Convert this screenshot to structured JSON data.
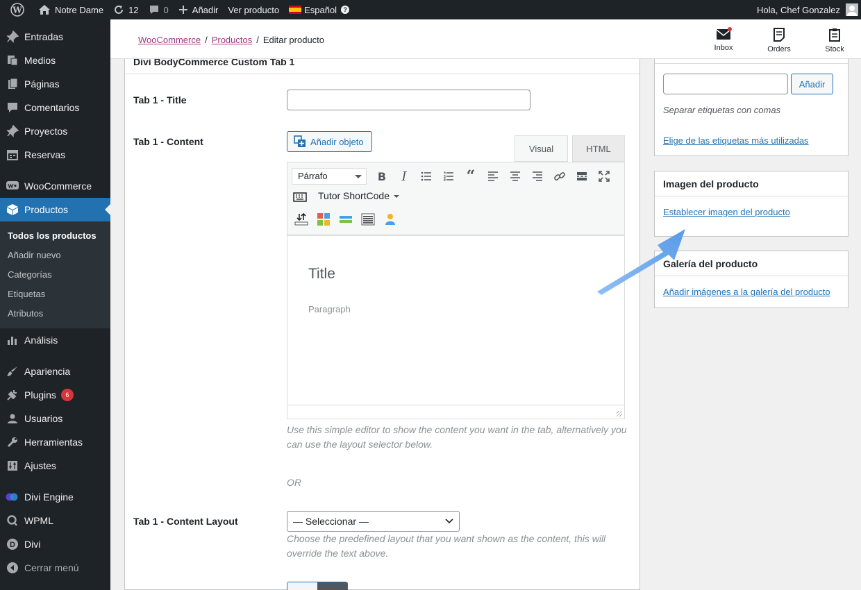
{
  "adminbar": {
    "site_name": "Notre Dame",
    "updates_count": "12",
    "comments_count": "0",
    "new_label": "Añadir",
    "view_label": "Ver producto",
    "language_label": "Español",
    "greeting": "Hola, Chef Gonzalez"
  },
  "sidebar": {
    "items_top": [
      {
        "label": "Entradas",
        "icon": "pushpin-icon"
      },
      {
        "label": "Medios",
        "icon": "media-icon"
      },
      {
        "label": "Páginas",
        "icon": "pages-icon"
      },
      {
        "label": "Comentarios",
        "icon": "comment-icon"
      },
      {
        "label": "Proyectos",
        "icon": "pushpin-icon"
      },
      {
        "label": "Reservas",
        "icon": "calendar-icon"
      }
    ],
    "woocommerce": "WooCommerce",
    "productos": "Productos",
    "submenu": [
      "Todos los productos",
      "Añadir nuevo",
      "Categorías",
      "Etiquetas",
      "Atributos"
    ],
    "analisis": "Análisis",
    "apariencia": "Apariencia",
    "plugins": "Plugins",
    "plugins_badge": "6",
    "usuarios": "Usuarios",
    "herramientas": "Herramientas",
    "ajustes": "Ajustes",
    "divi_engine": "Divi Engine",
    "wpml": "WPML",
    "divi": "Divi",
    "collapse": "Cerrar menú"
  },
  "header": {
    "crumb_1": "WooCommerce",
    "crumb_2": "Productos",
    "crumb_3": "Editar producto",
    "sep": "/",
    "inbox": "Inbox",
    "orders": "Orders",
    "stock": "Stock"
  },
  "panel": {
    "title": "Divi BodyCommerce Custom Tab 1",
    "tab_title_label": "Tab 1 - Title",
    "tab_title_value": "",
    "tab_content_label": "Tab 1 - Content",
    "add_object": "Añadir objeto",
    "tab_visual": "Visual",
    "tab_html": "HTML",
    "format_select": "Párrafo",
    "tutor_shortcode": "Tutor ShortCode",
    "editor_title": "Title",
    "editor_paragraph": "Paragraph",
    "help_text": "Use this simple editor to show the content you want in the tab, alternatively you can use the layout selector below.",
    "or_text": "OR",
    "layout_label": "Tab 1 - Content Layout",
    "layout_select": "— Seleccionar —",
    "layout_help": "Choose the predefined layout that you want shown as the content, this will override the text above."
  },
  "right": {
    "tag_button": "Añadir",
    "tag_input_value": "",
    "tag_hint": "Separar etiquetas con comas",
    "tag_popular": "Elige de las etiquetas más utilizadas",
    "image_title": "Imagen del producto",
    "image_link": "Establecer imagen del producto",
    "gallery_title": "Galería del producto",
    "gallery_link": "Añadir imágenes a la galería del producto"
  },
  "colors": {
    "admin_dark": "#1d2327",
    "active_blue": "#2271b1",
    "woo_purple": "#a0357f",
    "arrow_blue": "#6aa7ee"
  }
}
